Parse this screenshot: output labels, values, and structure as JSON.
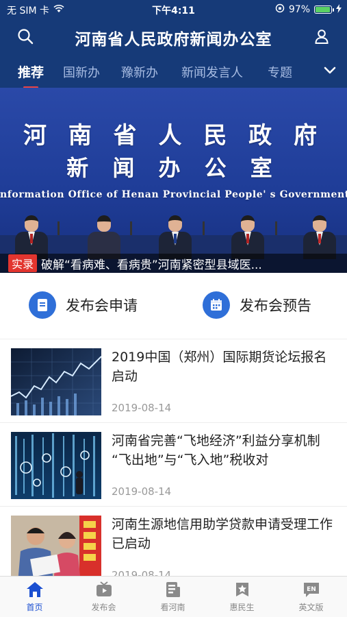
{
  "status": {
    "carrier": "无 SIM 卡",
    "time": "下午4:11",
    "battery": "97%",
    "battery_level": 0.97
  },
  "header": {
    "title": "河南省人民政府新闻办公室"
  },
  "tabs": [
    {
      "label": "推荐",
      "active": true
    },
    {
      "label": "国新办"
    },
    {
      "label": "豫新办"
    },
    {
      "label": "新闻发言人"
    },
    {
      "label": "专题"
    }
  ],
  "banner": {
    "line1": "河 南 省 人 民 政 府",
    "line2": "新 闻 办 公 室",
    "line3": "nformation Office of Henan Provincial People' s Government",
    "ticker_tag": "实录",
    "ticker_text": "破解“看病难、看病贵”河南紧密型县域医..."
  },
  "quick_actions": [
    {
      "label": "发布会申请",
      "icon": "document-icon"
    },
    {
      "label": "发布会预告",
      "icon": "calendar-icon"
    }
  ],
  "news": [
    {
      "headline": "2019中国（郑州）国际期货论坛报名启动",
      "date": "2019-08-14",
      "thumb": "stock-chart"
    },
    {
      "headline": "河南省完善“飞地经济”利益分享机制 “飞出地”与“飞入地”税收对",
      "date": "2019-08-14",
      "thumb": "digital-tech"
    },
    {
      "headline": "河南生源地信用助学贷款申请受理工作已启动",
      "date": "2019-08-14",
      "thumb": "students"
    }
  ],
  "tabbar": [
    {
      "label": "首页",
      "icon": "home-icon",
      "active": true
    },
    {
      "label": "发布会",
      "icon": "tv-icon"
    },
    {
      "label": "看河南",
      "icon": "news-icon"
    },
    {
      "label": "惠民生",
      "icon": "star-badge-icon"
    },
    {
      "label": "英文版",
      "icon": "en-icon",
      "badge": "EN"
    }
  ],
  "colors": {
    "brand": "#163a78",
    "accent": "#2f6fd8",
    "tab_active": "#1b4fd1",
    "indicator": "#e94444"
  }
}
